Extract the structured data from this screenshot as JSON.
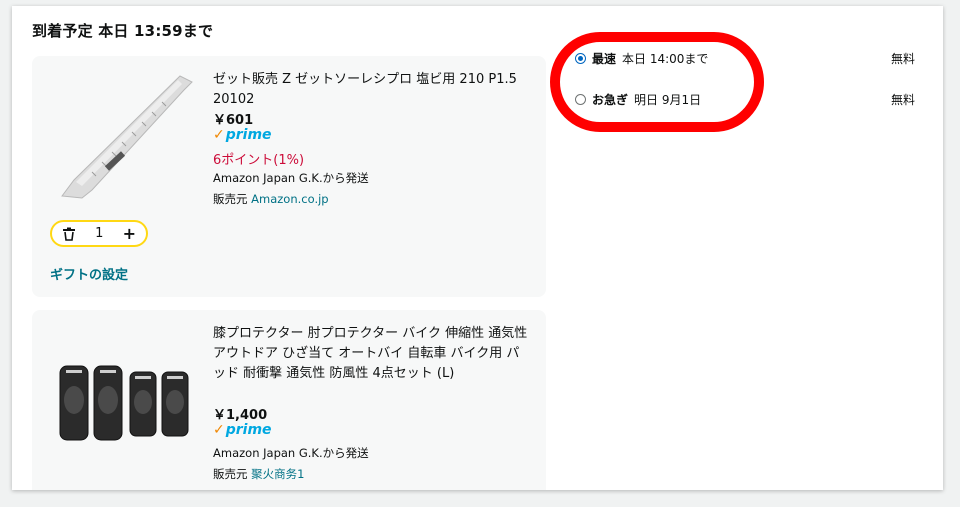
{
  "delivery": {
    "heading": "到着予定 本日 13:59まで"
  },
  "items": [
    {
      "title": "ゼット販売 Z ゼットソーレシプロ 塩ビ用 210 P1.5 20102",
      "price": "￥601",
      "prime_label": "prime",
      "points": "6ポイント(1%)",
      "ships_from": "Amazon Japan G.K.から発送",
      "seller_prefix": "販売元",
      "seller_name": "Amazon.co.jp",
      "quantity": "1",
      "gift_label": "ギフトの設定"
    },
    {
      "title": "膝プロテクター 肘プロテクター バイク 伸縮性 通気性 アウトドア ひざ当て オートバイ 自転車 バイク用 パッド 耐衝撃 通気性 防風性 4点セット (L)",
      "price": "￥1,400",
      "prime_label": "prime",
      "ships_from": "Amazon Japan G.K.から発送",
      "seller_prefix": "販売元",
      "seller_name": "聚火商务1"
    }
  ],
  "shipping_options": [
    {
      "label": "最速",
      "date": "本日 14:00まで",
      "fee": "無料",
      "selected": true
    },
    {
      "label": "お急ぎ",
      "date": "明日 9月1日",
      "fee": "無料",
      "selected": false
    }
  ],
  "colors": {
    "prime_blue": "#00a8e1",
    "prime_check": "#f08804",
    "points_red": "#cc0c39",
    "link": "#007185",
    "annotation_red": "#ff0000",
    "qty_border": "#ffd814"
  }
}
